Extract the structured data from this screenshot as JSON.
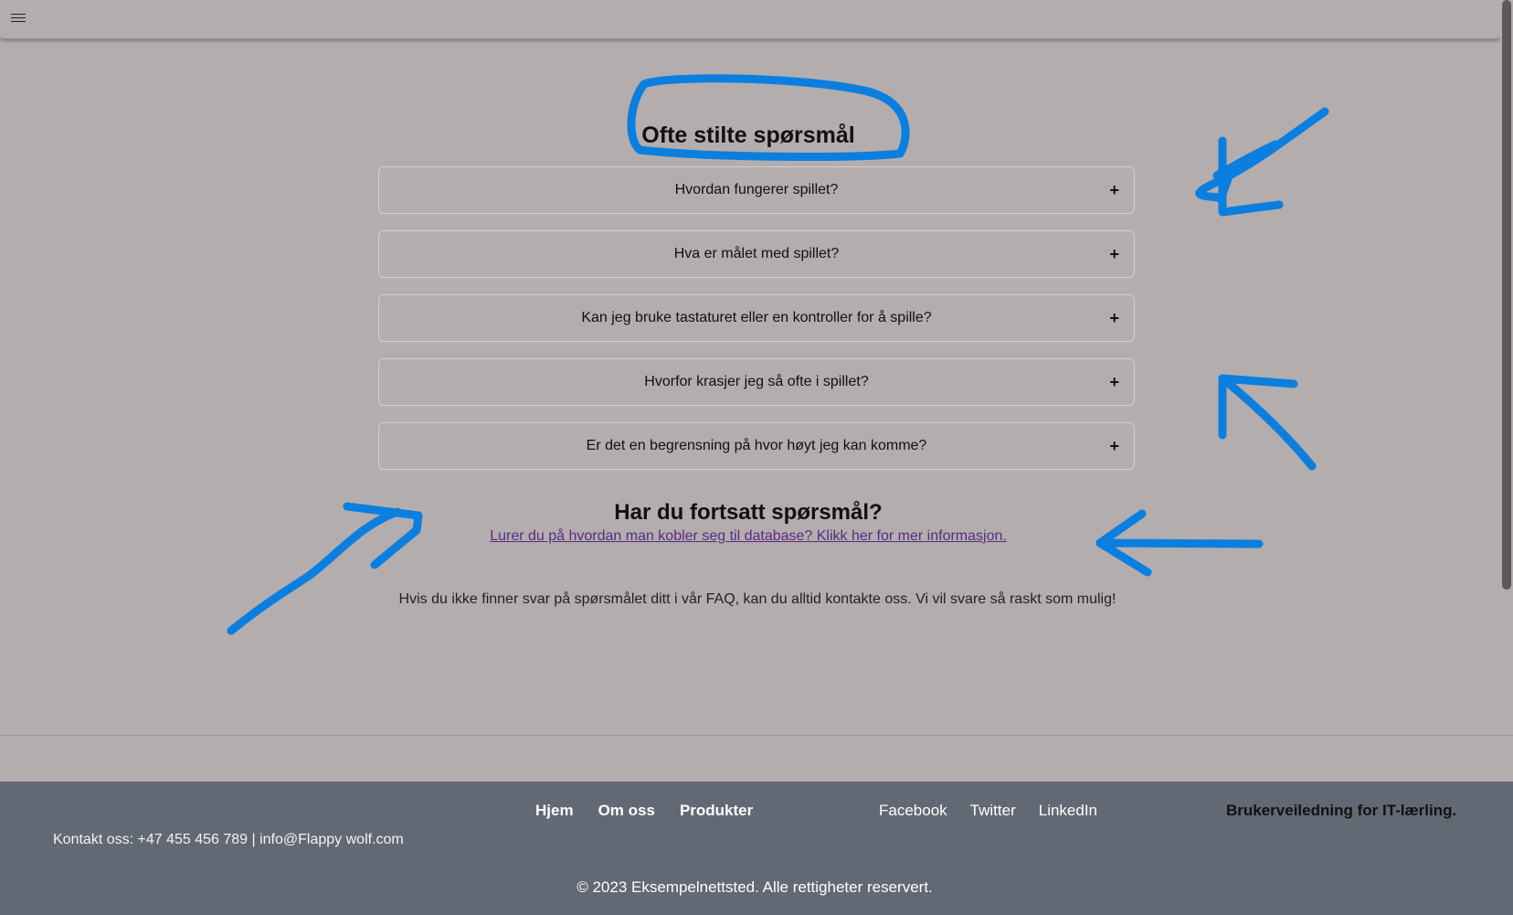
{
  "faq": {
    "title": "Ofte stilte spørsmål",
    "items": [
      {
        "question": "Hvordan fungerer spillet?",
        "toggle": "+"
      },
      {
        "question": "Hva er målet med spillet?",
        "toggle": "+"
      },
      {
        "question": "Kan jeg bruke tastaturet eller en kontroller for å spille?",
        "toggle": "+"
      },
      {
        "question": "Hvorfor krasjer jeg så ofte i spillet?",
        "toggle": "+"
      },
      {
        "question": "Er det en begrensning på hvor høyt jeg kan komme?",
        "toggle": "+"
      }
    ]
  },
  "more": {
    "title": "Har du fortsatt spørsmål?",
    "link": "Lurer du på hvordan man kobler seg til database? Klikk her for mer informasjon.",
    "text": "Hvis du ikke finner svar på spørsmålet ditt i vår FAQ, kan du alltid kontakte oss. Vi vil svare så raskt som mulig!"
  },
  "footer": {
    "nav": [
      "Hjem",
      "Om oss",
      "Produkter"
    ],
    "social": [
      "Facebook",
      "Twitter",
      "LinkedIn"
    ],
    "guide": "Brukerveiledning for IT-lærling.",
    "contact": "Kontakt oss: +47 455 456 789 | info@Flappy wolf.com",
    "copyright": "© 2023 Eksempelnettsted. Alle rettigheter reservert."
  },
  "icons": {
    "menu": "hamburger-menu-icon",
    "annotation_color": "#0a7fe0"
  }
}
